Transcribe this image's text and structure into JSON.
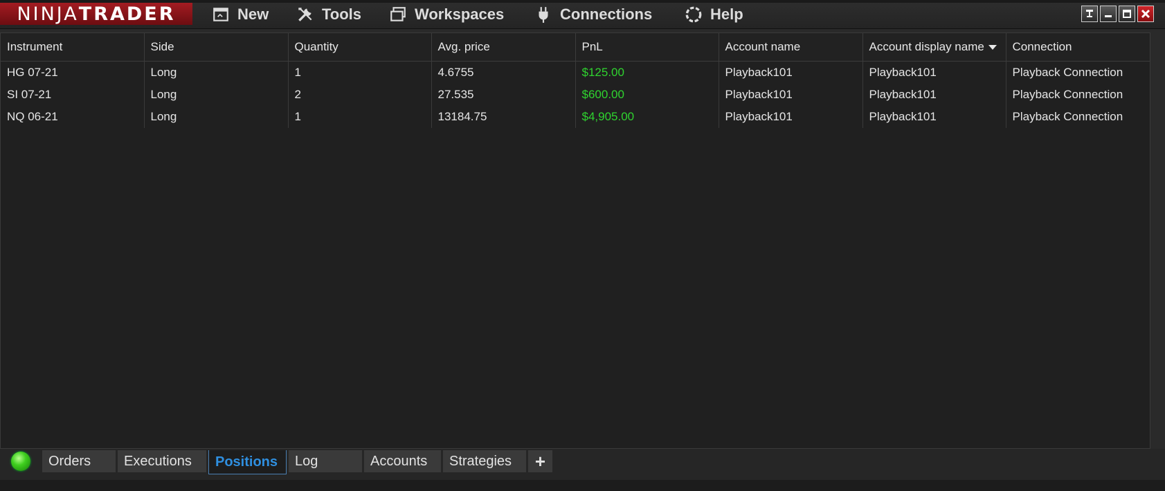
{
  "app": {
    "logo_left": "NINJA",
    "logo_right": "TRADER"
  },
  "menu": [
    {
      "label": "New",
      "icon": "new-window-icon"
    },
    {
      "label": "Tools",
      "icon": "tools-icon"
    },
    {
      "label": "Workspaces",
      "icon": "workspaces-icon"
    },
    {
      "label": "Connections",
      "icon": "plug-icon"
    },
    {
      "label": "Help",
      "icon": "help-icon"
    }
  ],
  "window_buttons": [
    "pin",
    "minimize",
    "maximize",
    "close"
  ],
  "grid": {
    "columns": [
      "Instrument",
      "Side",
      "Quantity",
      "Avg. price",
      "PnL",
      "Account name",
      "Account display name",
      "Connection"
    ],
    "sorted_column": "Account display name",
    "rows": [
      [
        "HG 07-21",
        "Long",
        "1",
        "4.6755",
        "$125.00",
        "Playback101",
        "Playback101",
        "Playback Connection"
      ],
      [
        "SI 07-21",
        "Long",
        "2",
        "27.535",
        "$600.00",
        "Playback101",
        "Playback101",
        "Playback Connection"
      ],
      [
        "NQ 06-21",
        "Long",
        "1",
        "13184.75",
        "$4,905.00",
        "Playback101",
        "Playback101",
        "Playback Connection"
      ]
    ]
  },
  "tabs": {
    "items": [
      "Orders",
      "Executions",
      "Positions",
      "Log",
      "Accounts",
      "Strategies"
    ],
    "active": "Positions",
    "add_label": "+"
  },
  "colors": {
    "pnl_positive": "#2fd32f",
    "active_tab": "#2f8fe0",
    "brand": "#a31c22",
    "status_connected": "#3fcf1f"
  }
}
